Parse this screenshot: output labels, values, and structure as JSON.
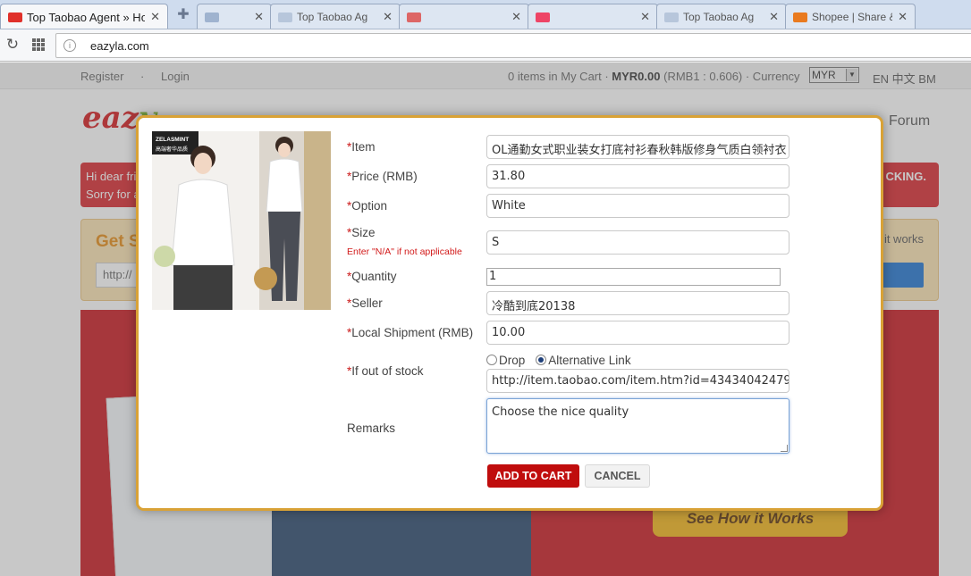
{
  "browser": {
    "tabs": [
      {
        "title": "Top Taobao Agent » Home",
        "active": true
      },
      {
        "title": "",
        "active": false
      },
      {
        "title": "Top Taobao Ag",
        "active": false
      },
      {
        "title": "",
        "active": false
      },
      {
        "title": "",
        "active": false
      },
      {
        "title": "Top Taobao Ag",
        "active": false
      },
      {
        "title": "Shopee | Share & ...",
        "active": false
      }
    ],
    "url": "eazyla.com"
  },
  "site": {
    "topbar": {
      "register": "Register",
      "separator": "·",
      "login": "Login",
      "cart_prefix": "0 items in My Cart · ",
      "cart_total": "MYR0.00",
      "cart_rate": " (RMB1 : 0.606) · Currency",
      "currency": "MYR",
      "langs": "EN 中文 BM"
    },
    "logo": {
      "main": "eaz",
      "accent": "y"
    },
    "nav_forum": "Forum",
    "alert": {
      "line1": "Hi dear fri",
      "line2": "Sorry for a",
      "line3": "CKING."
    },
    "getbox": {
      "title": "Get S",
      "how": "it works",
      "input_value": "http://"
    },
    "see_how": "See How it Works"
  },
  "modal": {
    "fields": {
      "item": {
        "label": "Item",
        "value": "OL通勤女式职业装女打底衬衫春秋韩版修身气质白领衬衣"
      },
      "price": {
        "label": "Price (RMB)",
        "value": "31.80"
      },
      "option": {
        "label": "Option",
        "value": "White"
      },
      "size": {
        "label": "Size",
        "hint": "Enter \"N/A\" if not applicable",
        "value": "S"
      },
      "quantity": {
        "label": "Quantity",
        "value": "1"
      },
      "seller": {
        "label": "Seller",
        "value": "冷酷到底20138"
      },
      "shipment": {
        "label": "Local Shipment (RMB)",
        "value": "10.00"
      },
      "out_of_stock": {
        "label": "If out of stock",
        "option_drop": "Drop",
        "option_alt": "Alternative Link",
        "selected": "Alternative Link",
        "alt_link": "http://item.taobao.com/item.htm?id=43434042479"
      },
      "remarks": {
        "label": "Remarks",
        "value": "Choose the nice quality"
      }
    },
    "required_mark": "*",
    "buttons": {
      "add": "ADD TO CART",
      "cancel": "CANCEL"
    },
    "image": {
      "brand_text": "ZELASMINT",
      "tag_text": "高端奢华品质"
    }
  }
}
